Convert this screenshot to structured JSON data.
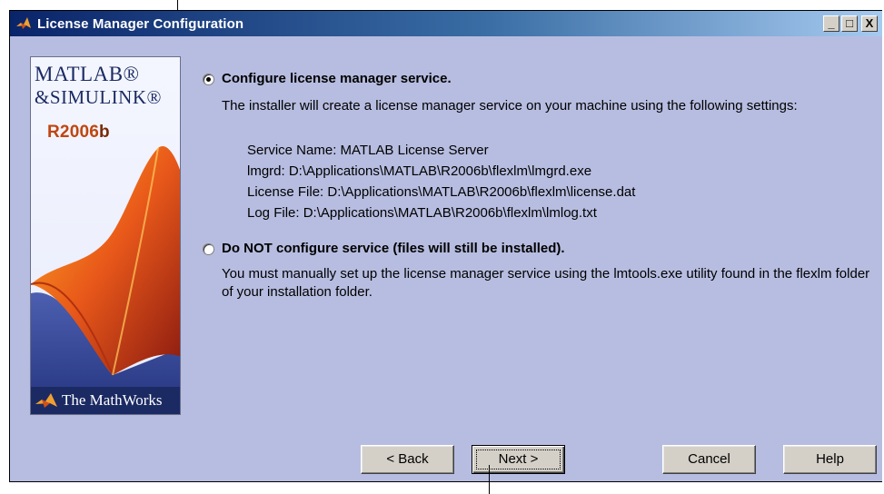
{
  "window": {
    "title": "License Manager Configuration",
    "controls": {
      "minimize": "_",
      "maximize": "□",
      "close": "X"
    }
  },
  "side_panel": {
    "brand_line1": "MATLAB®",
    "brand_line2": "&SIMULINK®",
    "release_prefix": "R2006",
    "release_suffix": "b",
    "company": "The MathWorks"
  },
  "options": [
    {
      "label": "Configure license manager service.",
      "selected": true,
      "description": "The installer will create a license manager service on your machine using the following settings:",
      "settings": [
        "Service Name:  MATLAB License Server",
        "lmgrd:  D:\\Applications\\MATLAB\\R2006b\\flexlm\\lmgrd.exe",
        "License File:  D:\\Applications\\MATLAB\\R2006b\\flexlm\\license.dat",
        "Log File:  D:\\Applications\\MATLAB\\R2006b\\flexlm\\lmlog.txt"
      ]
    },
    {
      "label": "Do NOT configure service (files will still be installed).",
      "selected": false,
      "description": "You must manually set up the license manager service using the lmtools.exe utility found in the flexlm folder of your installation folder."
    }
  ],
  "buttons": {
    "back": "< Back",
    "next": "Next >",
    "cancel": "Cancel",
    "help": "Help"
  },
  "colors": {
    "content_bg": "#b7bde0",
    "title_bar_start": "#0a246a",
    "button_face": "#d4d0c8"
  }
}
